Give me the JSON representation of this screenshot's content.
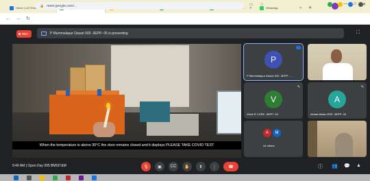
{
  "browser": {
    "tabs": [
      {
        "label": "Home | L&T Edu...",
        "color": "#1a73e8"
      },
      {
        "label": "Meet - Open Day 005...",
        "color": "#34a853",
        "active": true
      },
      {
        "label": "My Drive - Google Drive",
        "color": "#fbbc04"
      },
      {
        "label": "Review of PBL for Inte...",
        "color": "#0f9d58"
      },
      {
        "label": "Review of PBL for Inte...",
        "color": "#0f9d58"
      },
      {
        "label": "WhatsApp",
        "color": "#25d366"
      }
    ],
    "url": "meet.google.com/...",
    "window_controls": [
      "—",
      "□",
      "✕"
    ]
  },
  "meet": {
    "rec_label": "REC",
    "presenting_text": "P Mummalapur Dasari 000 -3EPP- 05 is presenting",
    "caption": "When the temperature is above 30°C the door remains closed and it displays PLEASE TAKE COVID TEST",
    "participants": [
      {
        "initial": "P",
        "name": "P Mummalapur Dasari 000 -3EPP- ...",
        "color": "#3f51b5"
      },
      {
        "initial": "V",
        "name": "Vivek R 1 EEE -3EPP- 03",
        "color": "#2e7d32"
      },
      {
        "initial": "A",
        "name": "Azhad Ahsan EEE -3EPP- 03",
        "color": "#26a69a"
      },
      {
        "initial": "",
        "name": "Others",
        "color": "#3c4043"
      }
    ],
    "others_avatars": [
      {
        "initial": "A",
        "color": "#c62828"
      },
      {
        "initial": "M",
        "color": "#1565c0"
      }
    ],
    "others_label": "24 others",
    "meeting_info": "9:40 AM  |  Open Day 005 BMSIT&M"
  },
  "colors": {
    "bg": "#202124",
    "tile": "#3c4043",
    "accent": "#8ab4f8",
    "danger": "#ea4335"
  }
}
